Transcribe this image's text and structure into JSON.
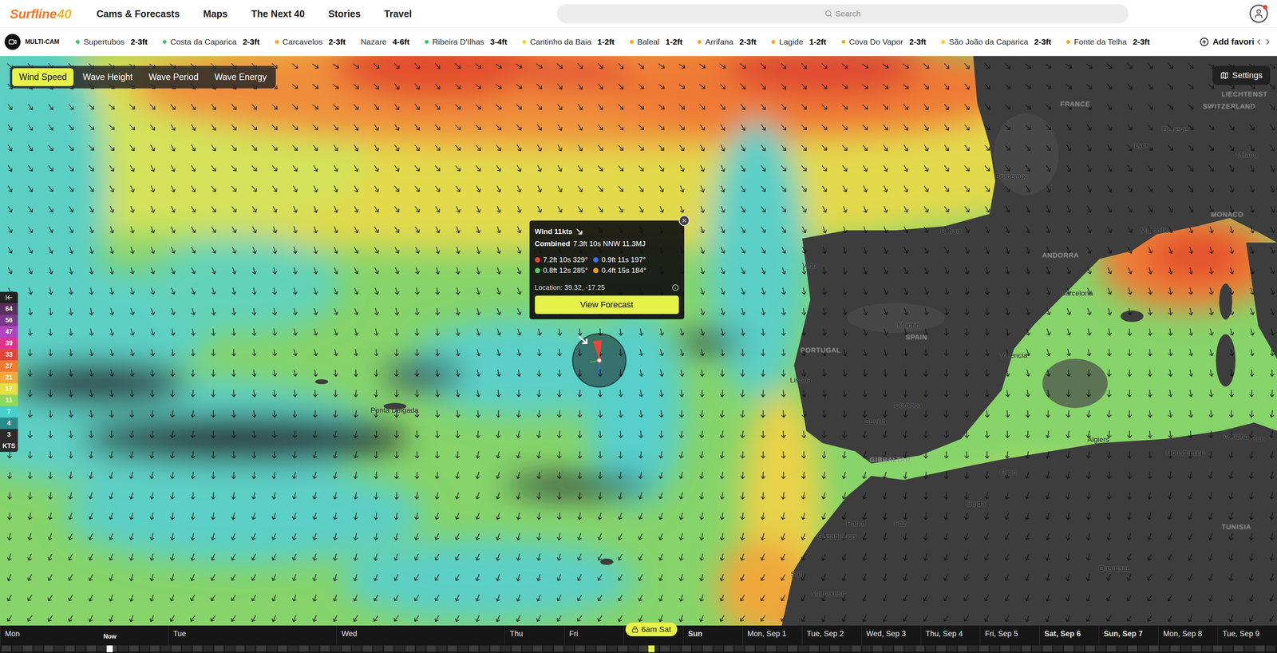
{
  "nav": {
    "logo": "Surfline",
    "logo_suffix": "40",
    "items": [
      {
        "label": "Cams & Forecasts"
      },
      {
        "label": "Maps"
      },
      {
        "label": "The Next 40"
      },
      {
        "label": "Stories"
      },
      {
        "label": "Travel"
      }
    ],
    "search_placeholder": "Search"
  },
  "favorites": {
    "multicam": "MULTI-CAM",
    "spots": [
      {
        "name": "Supertubos",
        "height": "2-3ft",
        "color": "#3ec46d"
      },
      {
        "name": "Costa da Caparica",
        "height": "2-3ft",
        "color": "#3ec46d"
      },
      {
        "name": "Carcavelos",
        "height": "2-3ft",
        "color": "#f5a623"
      },
      {
        "name": "Nazare",
        "height": "4-6ft"
      },
      {
        "name": "Ribeira D'Ilhas",
        "height": "3-4ft",
        "color": "#3ec46d"
      },
      {
        "name": "Cantinho da Baia",
        "height": "1-2ft",
        "color": "#f5d020"
      },
      {
        "name": "Baleal",
        "height": "1-2ft",
        "color": "#f5a623"
      },
      {
        "name": "Arrifana",
        "height": "2-3ft",
        "color": "#f5a623"
      },
      {
        "name": "Lagide",
        "height": "1-2ft",
        "color": "#f5a623"
      },
      {
        "name": "Cova Do Vapor",
        "height": "2-3ft",
        "color": "#f5a623"
      },
      {
        "name": "São João da Caparica",
        "height": "2-3ft",
        "color": "#f5d020"
      },
      {
        "name": "Fonte da Telha",
        "height": "2-3ft",
        "color": "#f5a623"
      }
    ],
    "add_label": "Add favori"
  },
  "layers": [
    {
      "label": "Wind Speed",
      "selected": true
    },
    {
      "label": "Wave Height",
      "selected": false
    },
    {
      "label": "Wave Period",
      "selected": false
    },
    {
      "label": "Wave Energy",
      "selected": false
    }
  ],
  "settings_label": "Settings",
  "legend": {
    "items": [
      {
        "label": "64",
        "color": "#5a2f5e"
      },
      {
        "label": "56",
        "color": "#7b3a8c"
      },
      {
        "label": "47",
        "color": "#b043c2"
      },
      {
        "label": "39",
        "color": "#e0338d"
      },
      {
        "label": "33",
        "color": "#e2453c"
      },
      {
        "label": "27",
        "color": "#ef7a32"
      },
      {
        "label": "21",
        "color": "#f2a83a"
      },
      {
        "label": "17",
        "color": "#e6e044"
      },
      {
        "label": "11",
        "color": "#8fd85c"
      },
      {
        "label": "7",
        "color": "#45cfcf"
      },
      {
        "label": "4",
        "color": "#2a8a8a"
      },
      {
        "label": "3",
        "color": "#2b2b2b"
      }
    ],
    "unit": "KTS"
  },
  "popup": {
    "wind": "Wind 11kts",
    "combined_label": "Combined",
    "combined": "7.3ft 10s NNW 11.3MJ",
    "swells": [
      {
        "text": "7.2ft 10s 329°",
        "color": "#e8453c"
      },
      {
        "text": "0.9ft 11s 197°",
        "color": "#3a6ee8"
      },
      {
        "text": "0.8ft 12s 285°",
        "color": "#4cc96b"
      },
      {
        "text": "0.4ft 15s 184°",
        "color": "#f59a23"
      }
    ],
    "location": "Location: 39.32, -17.25",
    "button": "View Forecast"
  },
  "map_labels": [
    {
      "text": "FRANCE",
      "kind": "country"
    },
    {
      "text": "LIECHTENST",
      "kind": "country"
    },
    {
      "text": "SWITZERLAND",
      "kind": "country"
    },
    {
      "text": "Genève",
      "kind": "city"
    },
    {
      "text": "Lyon",
      "kind": "city"
    },
    {
      "text": "Milano",
      "kind": "city"
    },
    {
      "text": "Bordeaux",
      "kind": "city"
    },
    {
      "text": "Bilbao",
      "kind": "city"
    },
    {
      "text": "Vigo",
      "kind": "city"
    },
    {
      "text": "ANDORRA",
      "kind": "country"
    },
    {
      "text": "MONACO",
      "kind": "country"
    },
    {
      "text": "Marseille",
      "kind": "city"
    },
    {
      "text": "Barcelona",
      "kind": "city"
    },
    {
      "text": "Madrid",
      "kind": "city"
    },
    {
      "text": "SPAIN",
      "kind": "country"
    },
    {
      "text": "PORTUGAL",
      "kind": "country"
    },
    {
      "text": "Lisboa",
      "kind": "city"
    },
    {
      "text": "València",
      "kind": "city"
    },
    {
      "text": "Córdoba",
      "kind": "city"
    },
    {
      "text": "Sevilla",
      "kind": "city"
    },
    {
      "text": "GIBRALTAR",
      "kind": "country"
    },
    {
      "text": "Algiers",
      "kind": "city"
    },
    {
      "text": "Annaba",
      "kind": "city"
    },
    {
      "text": "Tun",
      "kind": "city"
    },
    {
      "text": "Constantine",
      "kind": "city"
    },
    {
      "text": "Oran",
      "kind": "city"
    },
    {
      "text": "Oujda",
      "kind": "city"
    },
    {
      "text": "Rabat",
      "kind": "city"
    },
    {
      "text": "Fez",
      "kind": "city"
    },
    {
      "text": "Casablanca",
      "kind": "city"
    },
    {
      "text": "Safi",
      "kind": "city"
    },
    {
      "text": "Marrakesh",
      "kind": "city"
    },
    {
      "text": "Ghardaia",
      "kind": "city"
    },
    {
      "text": "TUNISIA",
      "kind": "country"
    },
    {
      "text": "Ponta Delgada",
      "kind": "city"
    }
  ],
  "timeline": {
    "now": "Now",
    "now_level": 0.086,
    "selected_label": "6am Sat",
    "selected_level": 0.51,
    "days": [
      {
        "label": "Mon",
        "weekend": false
      },
      {
        "label": "Tue",
        "weekend": false
      },
      {
        "label": "Wed",
        "weekend": false
      },
      {
        "label": "Thu",
        "weekend": false
      },
      {
        "label": "Fri",
        "weekend": false
      },
      {
        "label": "",
        "weekend": true
      },
      {
        "label": "Sun",
        "weekend": true
      },
      {
        "label": "Mon, Sep 1",
        "weekend": false
      },
      {
        "label": "Tue, Sep 2",
        "weekend": false
      },
      {
        "label": "Wed, Sep 3",
        "weekend": false
      },
      {
        "label": "Thu, Sep 4",
        "weekend": false
      },
      {
        "label": "Fri, Sep 5",
        "weekend": false
      },
      {
        "label": "Sat, Sep 6",
        "weekend": true
      },
      {
        "label": "Sun, Sep 7",
        "weekend": true
      },
      {
        "label": "Mon, Sep 8",
        "weekend": false
      },
      {
        "label": "Tue, Sep 9",
        "weekend": false
      }
    ]
  }
}
